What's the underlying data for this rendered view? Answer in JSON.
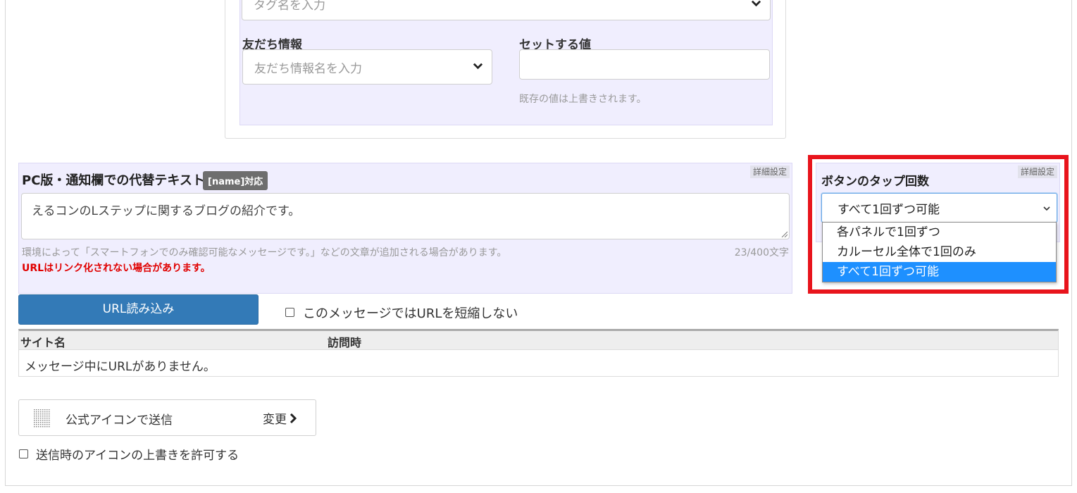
{
  "action": {
    "tag_select_placeholder": "タグ名を入力",
    "friend_info_label": "友だち情報",
    "friend_info_placeholder": "友だち情報名を入力",
    "set_value_label": "セットする値",
    "set_value": "",
    "set_value_hint": "既存の値は上書きされます。"
  },
  "alt_text": {
    "detail_tag": "詳細設定",
    "title": "PC版・通知欄での代替テキスト",
    "name_badge": "[name]対応",
    "value": "えるコンのLステップに関するブログの紹介です。",
    "note": "環境によって「スマートフォンでのみ確認可能なメッセージです。」などの文章が追加される場合があります。",
    "count": "23/400文字",
    "warning": "URLはリンク化されない場合があります。"
  },
  "tap_count": {
    "detail_tag": "詳細設定",
    "title": "ボタンのタップ回数",
    "selected": "すべて1回ずつ可能",
    "options": [
      "各パネルで1回ずつ",
      "カルーセル全体で1回のみ",
      "すべて1回ずつ可能"
    ],
    "highlight_color": "#e8141c"
  },
  "url": {
    "load_button": "URL読み込み",
    "no_shorten_label": "このメッセージではURLを短縮しない",
    "no_shorten_checked": false
  },
  "url_table": {
    "columns": [
      "サイト名",
      "訪問時"
    ],
    "empty_message": "メッセージ中にURLがありません。"
  },
  "sender_icon": {
    "label": "公式アイコンで送信",
    "change_label": "変更",
    "icon": "grid-dots-icon"
  },
  "allow_icon_override": {
    "label": "送信時のアイコンの上書きを許可する",
    "checked": false
  },
  "colors": {
    "primary_button": "#337ab7",
    "panel_bg": "#f0eefe",
    "selected_option": "#1e90ff",
    "warning": "#e00000"
  }
}
